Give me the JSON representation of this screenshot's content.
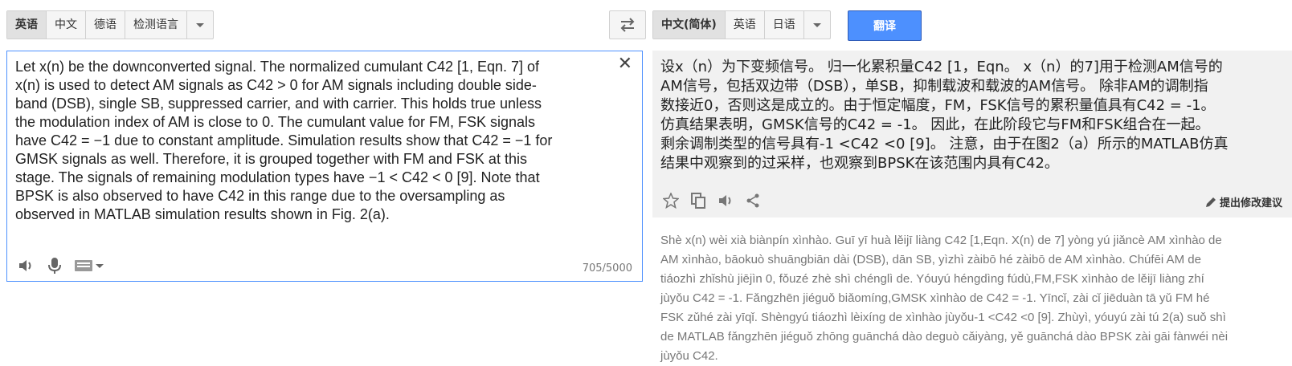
{
  "source_langs": [
    "英语",
    "中文",
    "德语",
    "检测语言"
  ],
  "target_langs": [
    "中文(简体)",
    "英语",
    "日语"
  ],
  "translate_button": "翻译",
  "source_text": "Let x(n) be the downconverted signal. The normalized cumulant C42 [1, Eqn. 7] of\nx(n) is used to detect AM signals as C42 > 0 for AM signals including double side-\nband (DSB), single SB, suppressed carrier, and with carrier. This holds true unless\nthe modulation index of AM is close to 0. The cumulant value for FM, FSK signals\nhave C42 = −1 due to constant amplitude. Simulation results show that C42 = −1 for\nGMSK signals as well. Therefore, it is grouped together with FM and FSK at this\nstage. The signals of remaining modulation types have −1 < C42 < 0 [9]. Note that\nBPSK is also observed to have C42 in this range due to the oversampling as\nobserved in MATLAB simulation results shown in Fig. 2(a).",
  "char_count": "705/5000",
  "translated_text": "设x（n）为下变频信号。 归一化累积量C42 [1，Eqn。 x（n）的7]用于检测AM信号的\nAM信号，包括双边带（DSB），单SB，抑制载波和载波的AM信号。 除非AM的调制指\n数接近0，否则这是成立的。由于恒定幅度，FM，FSK信号的累积量值具有C42 = -1。\n仿真结果表明，GMSK信号的C42 = -1。 因此，在此阶段它与FM和FSK组合在一起。\n剩余调制类型的信号具有-1 <C42 <0 [9]。 注意，由于在图2（a）所示的MATLAB仿真\n结果中观察到的过采样，也观察到BPSK在该范围内具有C42。",
  "suggest_edit": "提出修改建议",
  "romanization": "Shè x(n) wèi xià biànpín xìnhào. Guī yī huà lěijī liàng C42 [1,Eqn. X(n) de 7] yòng yú jiǎncè AM xìnhào de\nAM xìnhào, bāokuò shuāngbiān dài (DSB), dān SB, yìzhì zàibō hé zàibō de AM xìnhào. Chúfēi AM de\ntiáozhì zhǐshù jiējìn 0, fǒuzé zhè shì chénglì de. Yóuyú héngdìng fúdù,FM,FSK xìnhào de lěijī liàng zhí\njùyǒu C42 = -1. Fǎngzhēn jiéguǒ biǎomíng,GMSK xìnhào de C42 = -1. Yīncǐ, zài cǐ jiēduàn tā yǔ FM hé\nFSK zǔhé zài yīqǐ. Shèngyú tiáozhì lèixíng de xìnhào jùyǒu-1 <C42 <0 [9]. Zhùyì, yóuyú zài tú 2(a) suǒ shì\nde MATLAB fǎngzhēn jiéguǒ zhōng guānchá dào deguò cǎiyàng, yě guānchá dào BPSK zài gāi fànwéi nèi\njùyǒu C42.",
  "icons": {
    "swap": "swap-arrows-icon",
    "clear": "close-icon",
    "speaker": "speaker-icon",
    "mic": "microphone-icon",
    "keyboard": "keyboard-icon",
    "star": "star-icon",
    "copy": "copy-icon",
    "share": "share-icon",
    "pencil": "pencil-icon"
  },
  "colors": {
    "accent": "#4d90fe",
    "result_bg": "#f1f1f1"
  }
}
